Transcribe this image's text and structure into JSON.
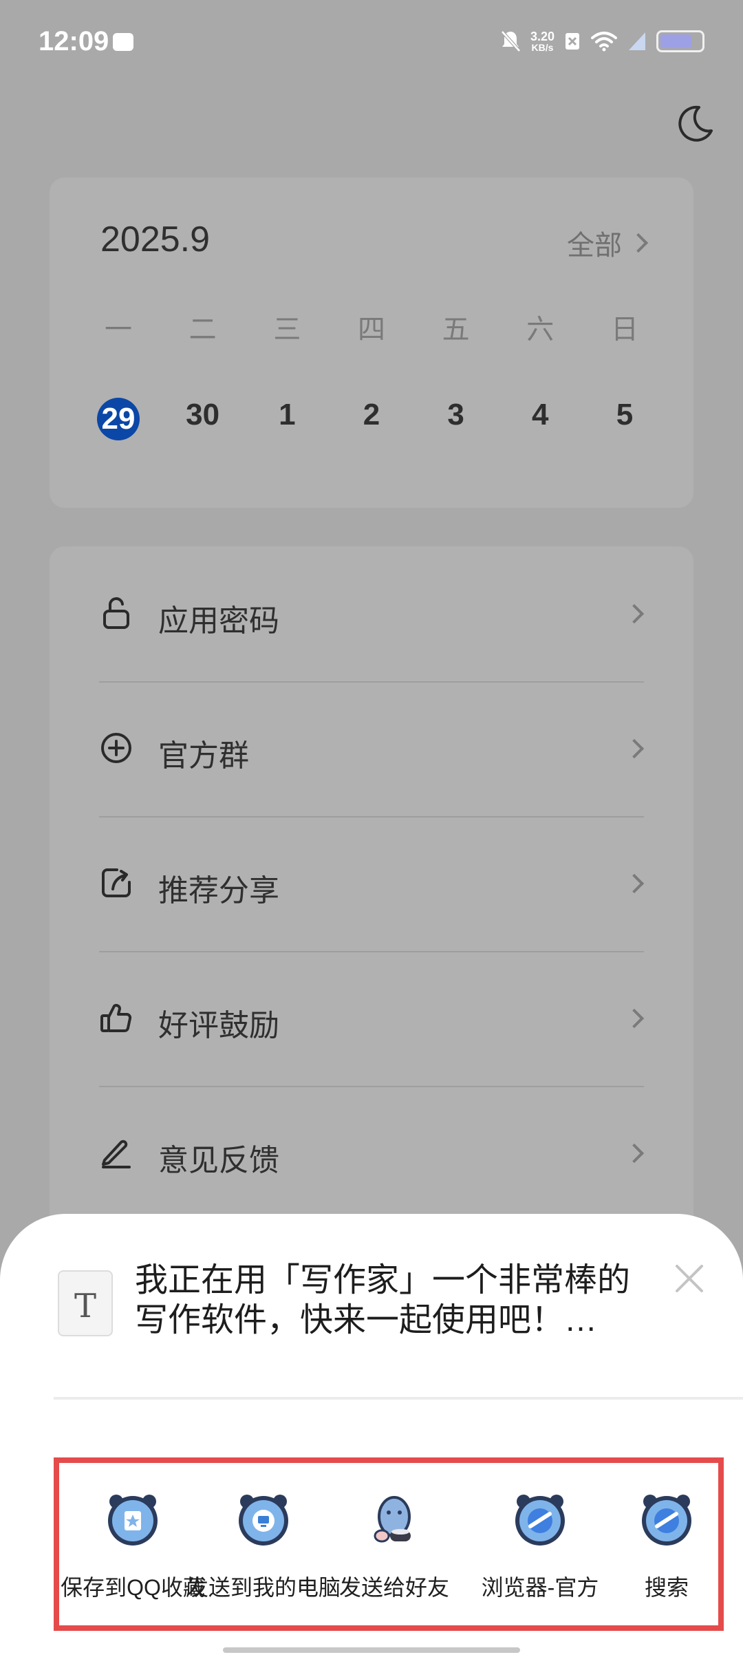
{
  "status_bar": {
    "time": "12:09",
    "net_speed_value": "3.20",
    "net_speed_unit": "KB/s"
  },
  "calendar": {
    "month_title": "2025.9",
    "all_label": "全部",
    "weekdays": [
      "一",
      "二",
      "三",
      "四",
      "五",
      "六",
      "日"
    ],
    "dates": [
      "29",
      "30",
      "1",
      "2",
      "3",
      "4",
      "5"
    ],
    "today_color": "#0B47A6"
  },
  "menu": {
    "items": [
      {
        "label": "应用密码",
        "icon": "unlock-icon"
      },
      {
        "label": "官方群",
        "icon": "add-circle-icon"
      },
      {
        "label": "推荐分享",
        "icon": "share-icon"
      },
      {
        "label": "好评鼓励",
        "icon": "thumbs-up-icon"
      },
      {
        "label": "意见反馈",
        "icon": "edit-icon"
      }
    ]
  },
  "share_sheet": {
    "doc_icon_letter": "T",
    "text": "我正在用「写作家」一个非常棒的写作软件，快来一起使用吧！…",
    "targets": [
      {
        "label": "保存到QQ收藏",
        "icon": "qq-favorites-icon"
      },
      {
        "label": "发送到我的电脑",
        "icon": "qq-computer-icon"
      },
      {
        "label": "发送给好友",
        "icon": "qq-friend-icon"
      },
      {
        "label": "浏览器-官方",
        "icon": "browser-icon"
      },
      {
        "label": "搜索",
        "icon": "search-icon"
      }
    ],
    "highlight_color": "#E54B4B"
  }
}
